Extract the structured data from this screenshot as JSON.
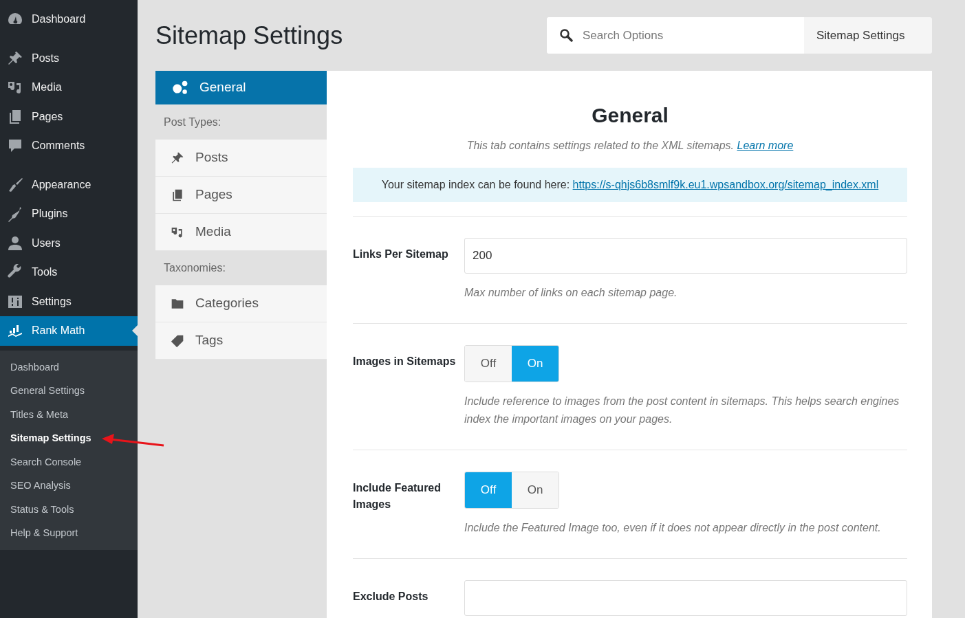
{
  "admin_menu": {
    "groups": [
      {
        "items": [
          {
            "label": "Dashboard",
            "selected": false
          }
        ]
      },
      {
        "items": [
          {
            "label": "Posts",
            "selected": false
          },
          {
            "label": "Media",
            "selected": false
          },
          {
            "label": "Pages",
            "selected": false
          },
          {
            "label": "Comments",
            "selected": false
          }
        ]
      },
      {
        "items": [
          {
            "label": "Appearance",
            "selected": false
          },
          {
            "label": "Plugins",
            "selected": false
          },
          {
            "label": "Users",
            "selected": false
          },
          {
            "label": "Tools",
            "selected": false
          },
          {
            "label": "Settings",
            "selected": false
          },
          {
            "label": "Rank Math",
            "selected": true
          }
        ]
      }
    ],
    "submenu": [
      {
        "label": "Dashboard",
        "selected": false
      },
      {
        "label": "General Settings",
        "selected": false
      },
      {
        "label": "Titles & Meta",
        "selected": false
      },
      {
        "label": "Sitemap Settings",
        "selected": true
      },
      {
        "label": "Search Console",
        "selected": false
      },
      {
        "label": "SEO Analysis",
        "selected": false
      },
      {
        "label": "Status & Tools",
        "selected": false
      },
      {
        "label": "Help & Support",
        "selected": false
      }
    ]
  },
  "page_title": "Sitemap Settings",
  "search": {
    "placeholder": "Search Options",
    "scope": "Sitemap Settings"
  },
  "tabs": [
    {
      "kind": "tab",
      "label": "General",
      "selected": true
    },
    {
      "kind": "heading",
      "label": "Post Types:"
    },
    {
      "kind": "tab",
      "label": "Posts",
      "selected": false
    },
    {
      "kind": "tab",
      "label": "Pages",
      "selected": false
    },
    {
      "kind": "tab",
      "label": "Media",
      "selected": false
    },
    {
      "kind": "heading",
      "label": "Taxonomies:"
    },
    {
      "kind": "tab",
      "label": "Categories",
      "selected": false
    },
    {
      "kind": "tab",
      "label": "Tags",
      "selected": false
    }
  ],
  "panel": {
    "title": "General",
    "description": "This tab contains settings related to the XML sitemaps.",
    "learn_more": "Learn more",
    "notice": {
      "text": "Your sitemap index can be found here:",
      "url": "https://s-qhjs6b8smlf9k.eu1.wpsandbox.org/sitemap_index.xml"
    },
    "settings": [
      {
        "kind": "text",
        "label": "Links Per Sitemap",
        "value": "200",
        "help": "Max number of links on each sitemap page."
      },
      {
        "kind": "toggle",
        "label": "Images in Sitemaps",
        "options": [
          {
            "label": "Off",
            "selected": false
          },
          {
            "label": "On",
            "selected": true
          }
        ],
        "help": "Include reference to images from the post content in sitemaps. This helps search engines index the important images on your pages."
      },
      {
        "kind": "toggle",
        "label": "Include Featured Images",
        "options": [
          {
            "label": "Off",
            "selected": true
          },
          {
            "label": "On",
            "selected": false
          }
        ],
        "help": "Include the Featured Image too, even if it does not appear directly in the post content."
      },
      {
        "kind": "text",
        "label": "Exclude Posts"
      }
    ]
  }
}
